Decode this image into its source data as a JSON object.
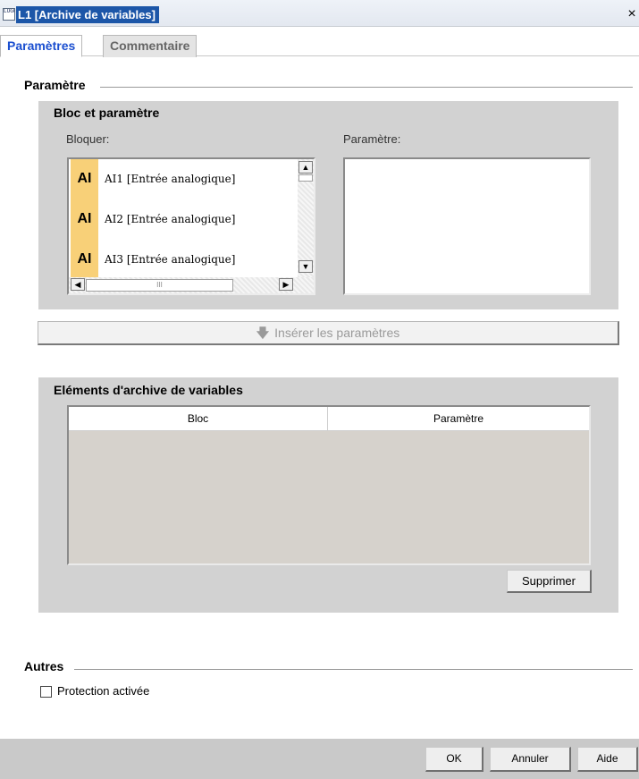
{
  "window": {
    "title": "L1 [Archive de variables]",
    "app_icon_text": "LOGO",
    "close_glyph": "×"
  },
  "tabs": [
    {
      "label": "Paramètres",
      "active": true
    },
    {
      "label": "Commentaire",
      "active": false
    }
  ],
  "parametre_group": {
    "title": "Paramètre",
    "bloc_panel": {
      "title": "Bloc et paramètre",
      "bloquer_label": "Bloquer:",
      "parametre_label": "Paramètre:",
      "items": [
        {
          "badge": "AI",
          "label": "AI1 [Entrée analogique]"
        },
        {
          "badge": "AI",
          "label": "AI2 [Entrée analogique]"
        },
        {
          "badge": "AI",
          "label": "AI3 [Entrée analogique]"
        }
      ],
      "hscroll_grip": "III"
    },
    "insert_button": {
      "icon": "arrow-down-icon",
      "label": "Insérer les paramètres",
      "enabled": false
    },
    "elements_panel": {
      "title": "Eléments d'archive de variables",
      "columns": [
        "Bloc",
        "Paramètre"
      ],
      "rows": [],
      "delete_button": "Supprimer"
    }
  },
  "autres_group": {
    "title": "Autres",
    "protection_label": "Protection activée",
    "protection_checked": false
  },
  "footer": {
    "ok": "OK",
    "annuler": "Annuler",
    "aide": "Aide"
  },
  "colors": {
    "titlebar_highlight": "#1c56a8",
    "active_tab_text": "#1b4fd0",
    "badge_bg": "#f8d078",
    "panel_bg": "#d2d2d2"
  }
}
